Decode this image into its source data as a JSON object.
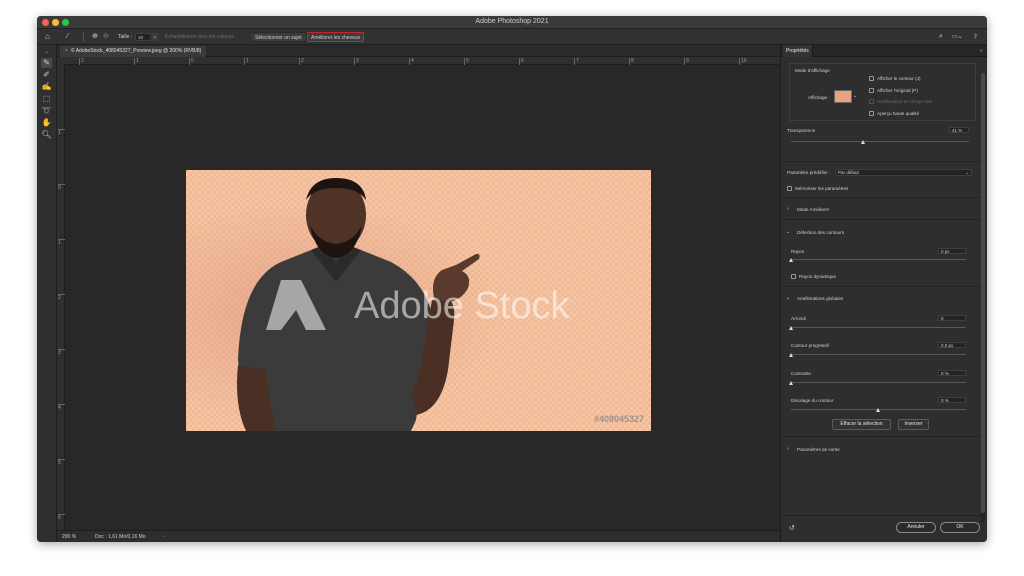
{
  "app": {
    "title": "Adobe Photoshop 2021"
  },
  "options_bar": {
    "size_label": "Taille :",
    "size_value": "10",
    "sample_all_layers": "Échantillonner tous les calques",
    "select_subject": "Sélectionner un sujet",
    "refine_hair": "Améliorer les cheveux"
  },
  "document": {
    "tab_title": "© AdobeStock_408045327_Preview.jpeg @ 200% (RVB/8)",
    "watermark_brand": "Adobe Stock",
    "watermark_id": "#408045327"
  },
  "rulers": {
    "h": [
      "2",
      "1",
      "0",
      "1",
      "2",
      "3",
      "4",
      "5",
      "6",
      "7",
      "8",
      "9",
      "10"
    ],
    "v": [
      "1",
      "0",
      "1",
      "2",
      "3",
      "4",
      "5",
      "6"
    ]
  },
  "status": {
    "zoom": "200 %",
    "doc_info": "Doc : 1,61 Mo/0,16 Mo"
  },
  "panel": {
    "tab": "Propriétés",
    "view_mode": {
      "title": "Mode d'affichage",
      "display_label": "Affichage :",
      "show_edge": "Afficher le contour (J)",
      "show_original": "Afficher l'original (P)",
      "realtime_refine": "Amélioration en temps réel",
      "high_quality": "Aperçu haute qualité"
    },
    "transparency": {
      "label": "Transparence",
      "value": "41 %",
      "level": 0.41
    },
    "preset": {
      "label": "Paramètre prédéfini :",
      "value": "Par défaut",
      "remember": "Mémoriser les paramètres"
    },
    "sections": {
      "refine_mode": "Mode Améliorer",
      "edge_detection": "Détection des contours",
      "global_refinements": "Améliorations globales",
      "output_settings": "Paramètres de sortie"
    },
    "radius": {
      "label": "Rayon",
      "value": "0 px",
      "level": 0,
      "smart": "Rayon dynamique"
    },
    "smooth": {
      "label": "Arrondi",
      "value": "0",
      "level": 0
    },
    "feather": {
      "label": "Contour progressif",
      "value": "0,0 px",
      "level": 0
    },
    "contrast": {
      "label": "Contraste",
      "value": "0 %",
      "level": 0
    },
    "shift_edge": {
      "label": "Décalage du contour",
      "value": "0 %",
      "level": 0.5
    },
    "clear_selection": "Effacer la sélection",
    "invert": "Inverser",
    "cancel": "Annuler",
    "ok": "OK"
  },
  "colors": {
    "highlight": "#c4262b",
    "background_peach": "#f1b994",
    "close": "#ff5f57",
    "minimize": "#febc2e",
    "zoom": "#28c840"
  }
}
